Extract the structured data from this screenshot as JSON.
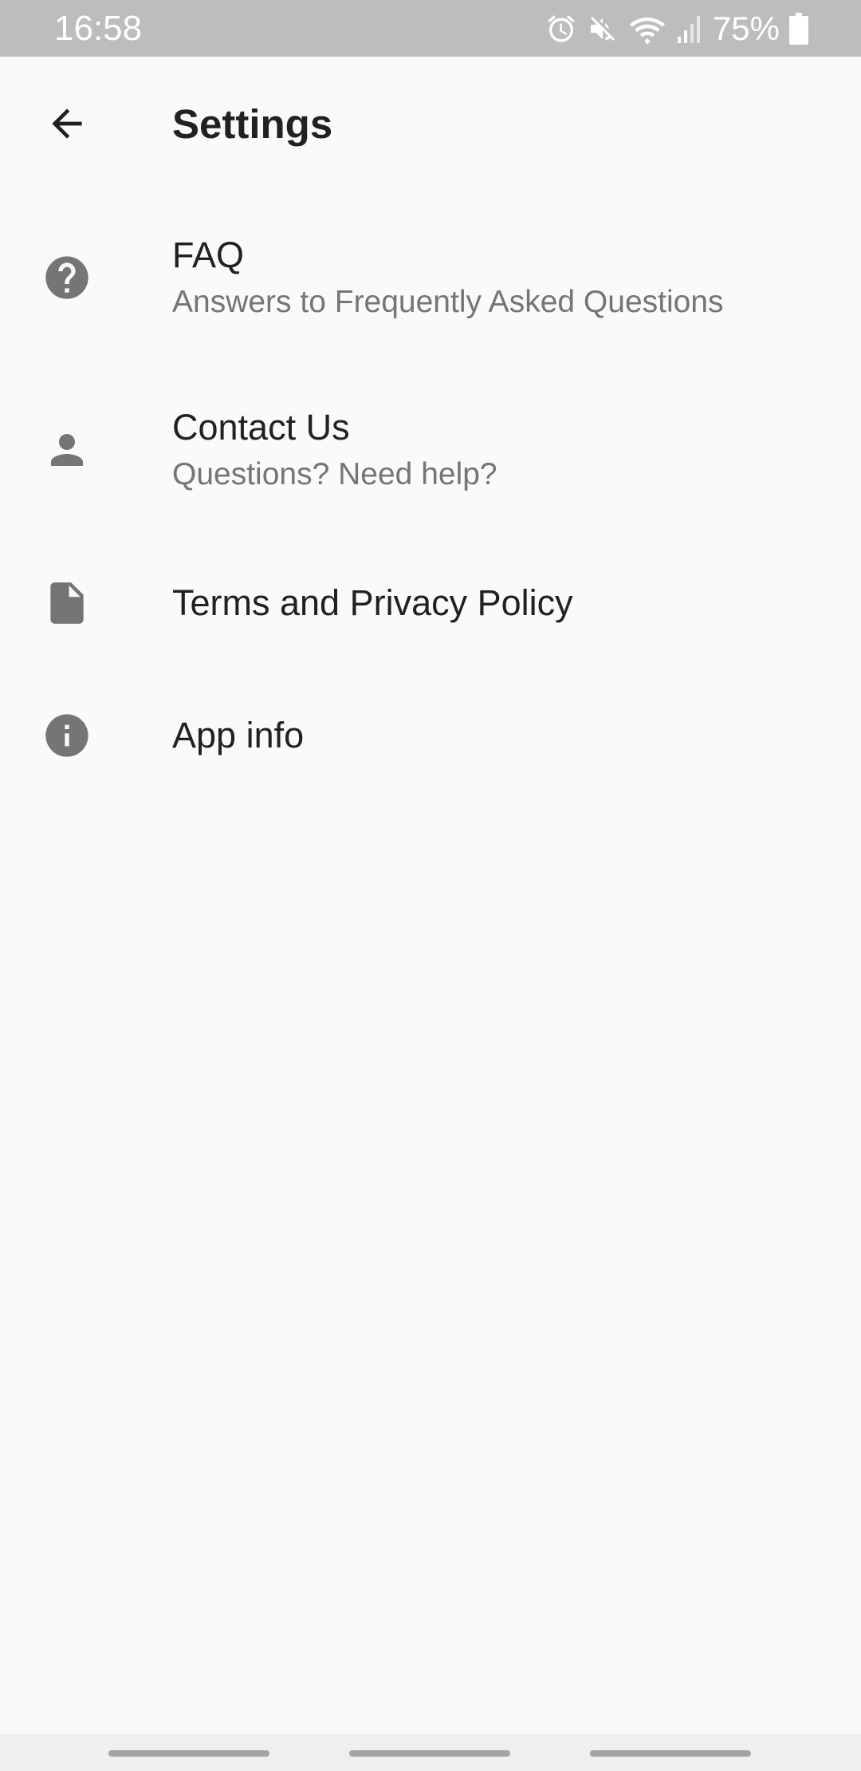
{
  "status_bar": {
    "time": "16:58",
    "battery_percent": "75%",
    "icons": [
      "alarm-icon",
      "mute-icon",
      "wifi-icon",
      "signal-icon",
      "battery-icon"
    ]
  },
  "app_bar": {
    "title": "Settings",
    "back_icon": "arrow-back-icon"
  },
  "settings_items": [
    {
      "title": "FAQ",
      "subtitle": "Answers to Frequently Asked Questions",
      "icon": "help-circle-icon"
    },
    {
      "title": "Contact Us",
      "subtitle": "Questions? Need help?",
      "icon": "person-icon"
    },
    {
      "title": "Terms and Privacy Policy",
      "icon": "document-icon"
    },
    {
      "title": "App info",
      "icon": "info-circle-icon"
    }
  ],
  "colors": {
    "status_bar": "#bdbdbd",
    "background": "#fafafa",
    "title_text": "#212121",
    "subtitle_text": "#757575",
    "icon": "#757575"
  }
}
